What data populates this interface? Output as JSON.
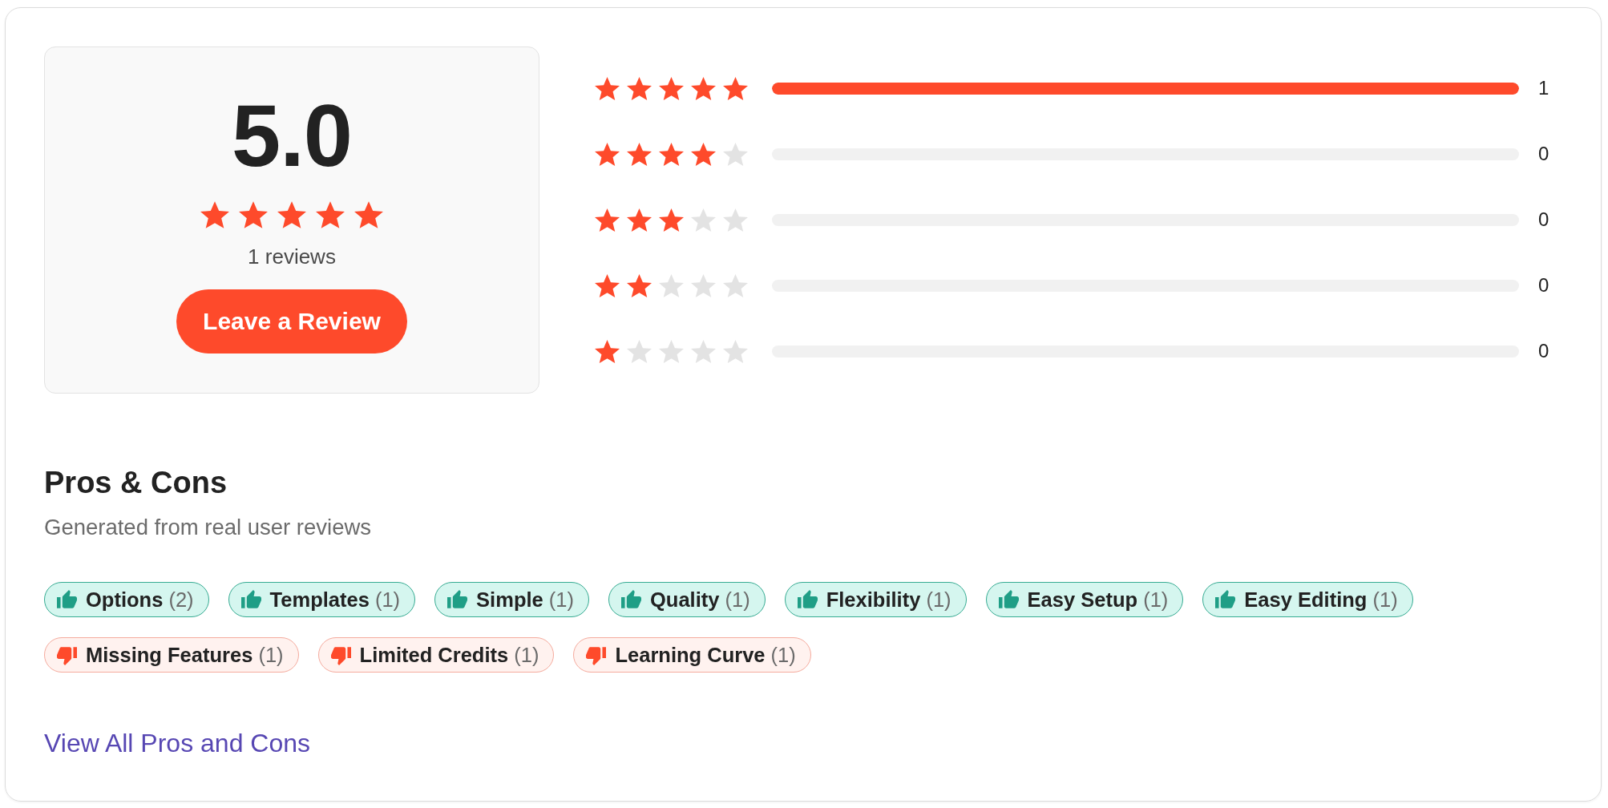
{
  "summary": {
    "score": "5.0",
    "stars": 5,
    "review_count": "1 reviews",
    "button": "Leave a Review"
  },
  "breakdown": [
    {
      "stars": 5,
      "level": 1,
      "count": "1"
    },
    {
      "stars": 4,
      "level": 0,
      "count": "0"
    },
    {
      "stars": 3,
      "level": 0,
      "count": "0"
    },
    {
      "stars": 2,
      "level": 0,
      "count": "0"
    },
    {
      "stars": 1,
      "level": 0,
      "count": "0"
    }
  ],
  "pros_cons": {
    "title": "Pros & Cons",
    "subtitle": "Generated from real user reviews",
    "pros": [
      {
        "label": "Options",
        "count": "(2)"
      },
      {
        "label": "Templates",
        "count": "(1)"
      },
      {
        "label": "Simple",
        "count": "(1)"
      },
      {
        "label": "Quality",
        "count": "(1)"
      },
      {
        "label": "Flexibility",
        "count": "(1)"
      },
      {
        "label": "Easy Setup",
        "count": "(1)"
      },
      {
        "label": "Easy Editing",
        "count": "(1)"
      }
    ],
    "cons": [
      {
        "label": "Missing Features",
        "count": "(1)"
      },
      {
        "label": "Limited Credits",
        "count": "(1)"
      },
      {
        "label": "Learning Curve",
        "count": "(1)"
      }
    ],
    "link": "View All Pros and Cons"
  }
}
